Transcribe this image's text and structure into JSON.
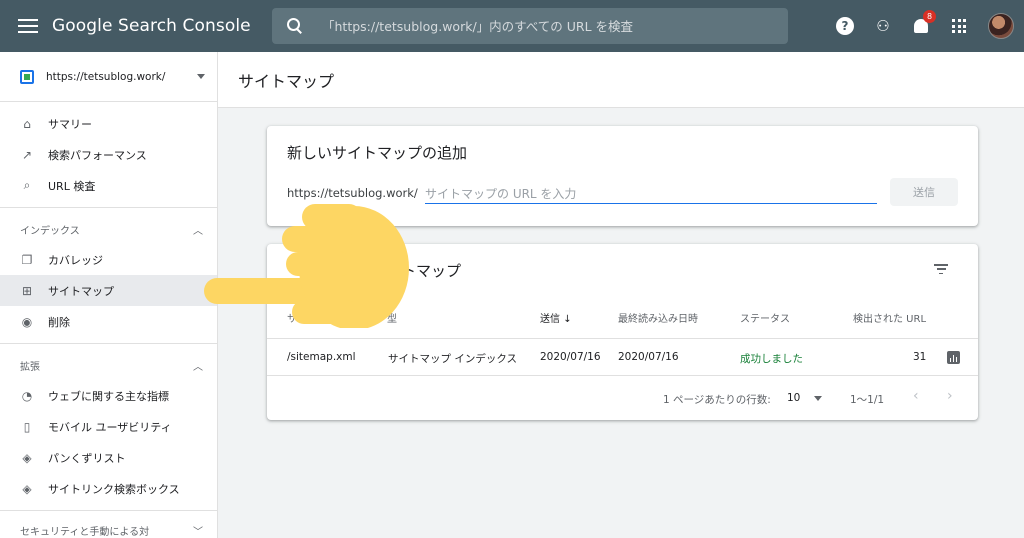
{
  "app": {
    "title": "Google Search Console"
  },
  "search": {
    "placeholder": "「https://tetsublog.work/」内のすべての URL を検査"
  },
  "notifications": {
    "count": "8"
  },
  "icons": {
    "menu": "menu-icon",
    "search": "search-icon",
    "help": "help-icon",
    "users": "manage-users-icon",
    "bell": "bell-icon",
    "apps": "apps-icon",
    "avatar": "avatar"
  },
  "property": {
    "label": "https://tetsublog.work/"
  },
  "sidebar": {
    "top_items": [
      {
        "label": "サマリー",
        "icon": "home-icon"
      },
      {
        "label": "検索パフォーマンス",
        "icon": "trending-up-icon"
      },
      {
        "label": "URL 検査",
        "icon": "search-icon"
      }
    ],
    "index": {
      "title": "インデックス",
      "items": [
        {
          "label": "カバレッジ",
          "icon": "copy-icon"
        },
        {
          "label": "サイトマップ",
          "icon": "sitemap-icon"
        },
        {
          "label": "削除",
          "icon": "visibility-off-icon"
        }
      ]
    },
    "enhancements": {
      "title": "拡張",
      "items": [
        {
          "label": "ウェブに関する主な指標",
          "icon": "speed-icon"
        },
        {
          "label": "モバイル ユーザビリティ",
          "icon": "smartphone-icon"
        },
        {
          "label": "パンくずリスト",
          "icon": "layers-icon"
        },
        {
          "label": "サイトリンク検索ボックス",
          "icon": "layers-icon"
        }
      ]
    },
    "security": {
      "title": "セキュリティと手動による対"
    }
  },
  "page": {
    "title": "サイトマップ"
  },
  "add_card": {
    "title": "新しいサイトマップの追加",
    "url_prefix": "https://tetsublog.work/",
    "input_placeholder": "サイトマップの URL を入力",
    "submit_label": "送信"
  },
  "submitted_card": {
    "title": "トマップ",
    "columns": [
      "サイトマ",
      "型",
      "送信",
      "最終読み込み日時",
      "ステータス",
      "検出された URL"
    ],
    "sort_arrow": "↓",
    "rows": [
      {
        "sitemap": "/sitemap.xml",
        "type": "サイトマップ インデックス",
        "submitted": "2020/07/16",
        "last_read": "2020/07/16",
        "status": "成功しました",
        "urls": "31"
      }
    ],
    "pager": {
      "rows_per_page_label": "1 ページあたりの行数:",
      "rows_per_page": "10",
      "range": "1〜1/1"
    }
  },
  "colors": {
    "topbar": "#455a64",
    "accent": "#1a73e8",
    "success": "#188038",
    "hand": "#fdd663"
  }
}
